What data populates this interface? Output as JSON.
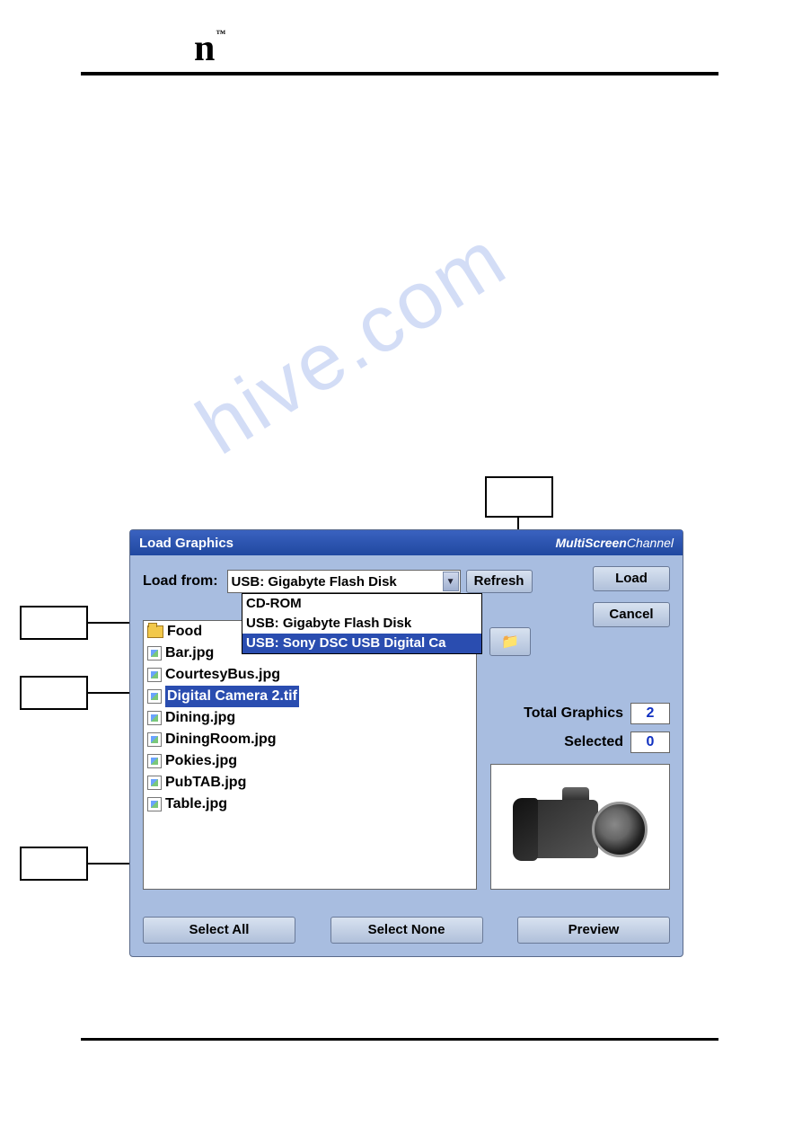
{
  "header": {
    "logo_letter": "n"
  },
  "watermark": "hive.com",
  "dialog": {
    "title": "Load Graphics",
    "brand_prefix": "MultiScreen",
    "brand_suffix": "Channel",
    "load_from_label": "Load from:",
    "combo_value": "USB: Gigabyte Flash Disk",
    "dropdown_options": [
      {
        "label": "CD-ROM",
        "selected": false
      },
      {
        "label": "USB: Gigabyte Flash Disk",
        "selected": false
      },
      {
        "label": "USB: Sony DSC USB Digital Ca",
        "selected": true
      }
    ],
    "buttons": {
      "refresh": "Refresh",
      "load": "Load",
      "cancel": "Cancel",
      "select_all": "Select All",
      "select_none": "Select None",
      "preview": "Preview"
    },
    "files": [
      {
        "name": "Food",
        "type": "folder",
        "selected": false
      },
      {
        "name": "Bar.jpg",
        "type": "image",
        "selected": false
      },
      {
        "name": "CourtesyBus.jpg",
        "type": "image",
        "selected": false
      },
      {
        "name": "Digital Camera 2.tif",
        "type": "image",
        "selected": true
      },
      {
        "name": "Dining.jpg",
        "type": "image",
        "selected": false
      },
      {
        "name": "DiningRoom.jpg",
        "type": "image",
        "selected": false
      },
      {
        "name": "Pokies.jpg",
        "type": "image",
        "selected": false
      },
      {
        "name": "PubTAB.jpg",
        "type": "image",
        "selected": false
      },
      {
        "name": "Table.jpg",
        "type": "image",
        "selected": false
      }
    ],
    "stats": {
      "total_label": "Total Graphics",
      "total_value": "2",
      "selected_label": "Selected",
      "selected_value": "0"
    },
    "folder_up_icon": "📁"
  }
}
